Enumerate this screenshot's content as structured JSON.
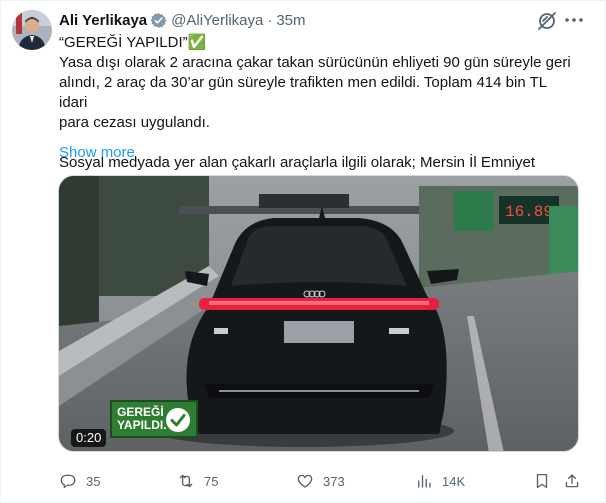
{
  "author": {
    "name": "Ali Yerlikaya",
    "handle": "@AliYerlikaya",
    "separator": "·",
    "time": "35m",
    "avatar_icon": "profile-photo-icon",
    "verified_color": "#829aab"
  },
  "post": {
    "lines": [
      "“GEREĞİ YAPILDI”✅",
      "Yasa dışı olarak 2 aracına çakar takan sürücünün ehliyeti 90 gün süreyle geri",
      "alındı, 2 araç da 30’ar gün süreyle trafikten men edildi. Toplam 414 bin TL idari",
      "para cezası uygulandı.",
      "",
      "Sosyal medyada yer alan çakarlı araçlarla ilgili olarak; Mersin İl Emniyet"
    ],
    "show_more": "Show more"
  },
  "media": {
    "duration": "0:20",
    "stamp_text": "GEREĞİ YAPILDI.",
    "sign_text": "16.89",
    "stamp_color": "#2e7d32"
  },
  "actions": {
    "replies": "35",
    "reposts": "75",
    "likes": "373",
    "views": "14K"
  },
  "colors": {
    "accent": "#1d9bf0",
    "secondary_text": "#536471"
  }
}
